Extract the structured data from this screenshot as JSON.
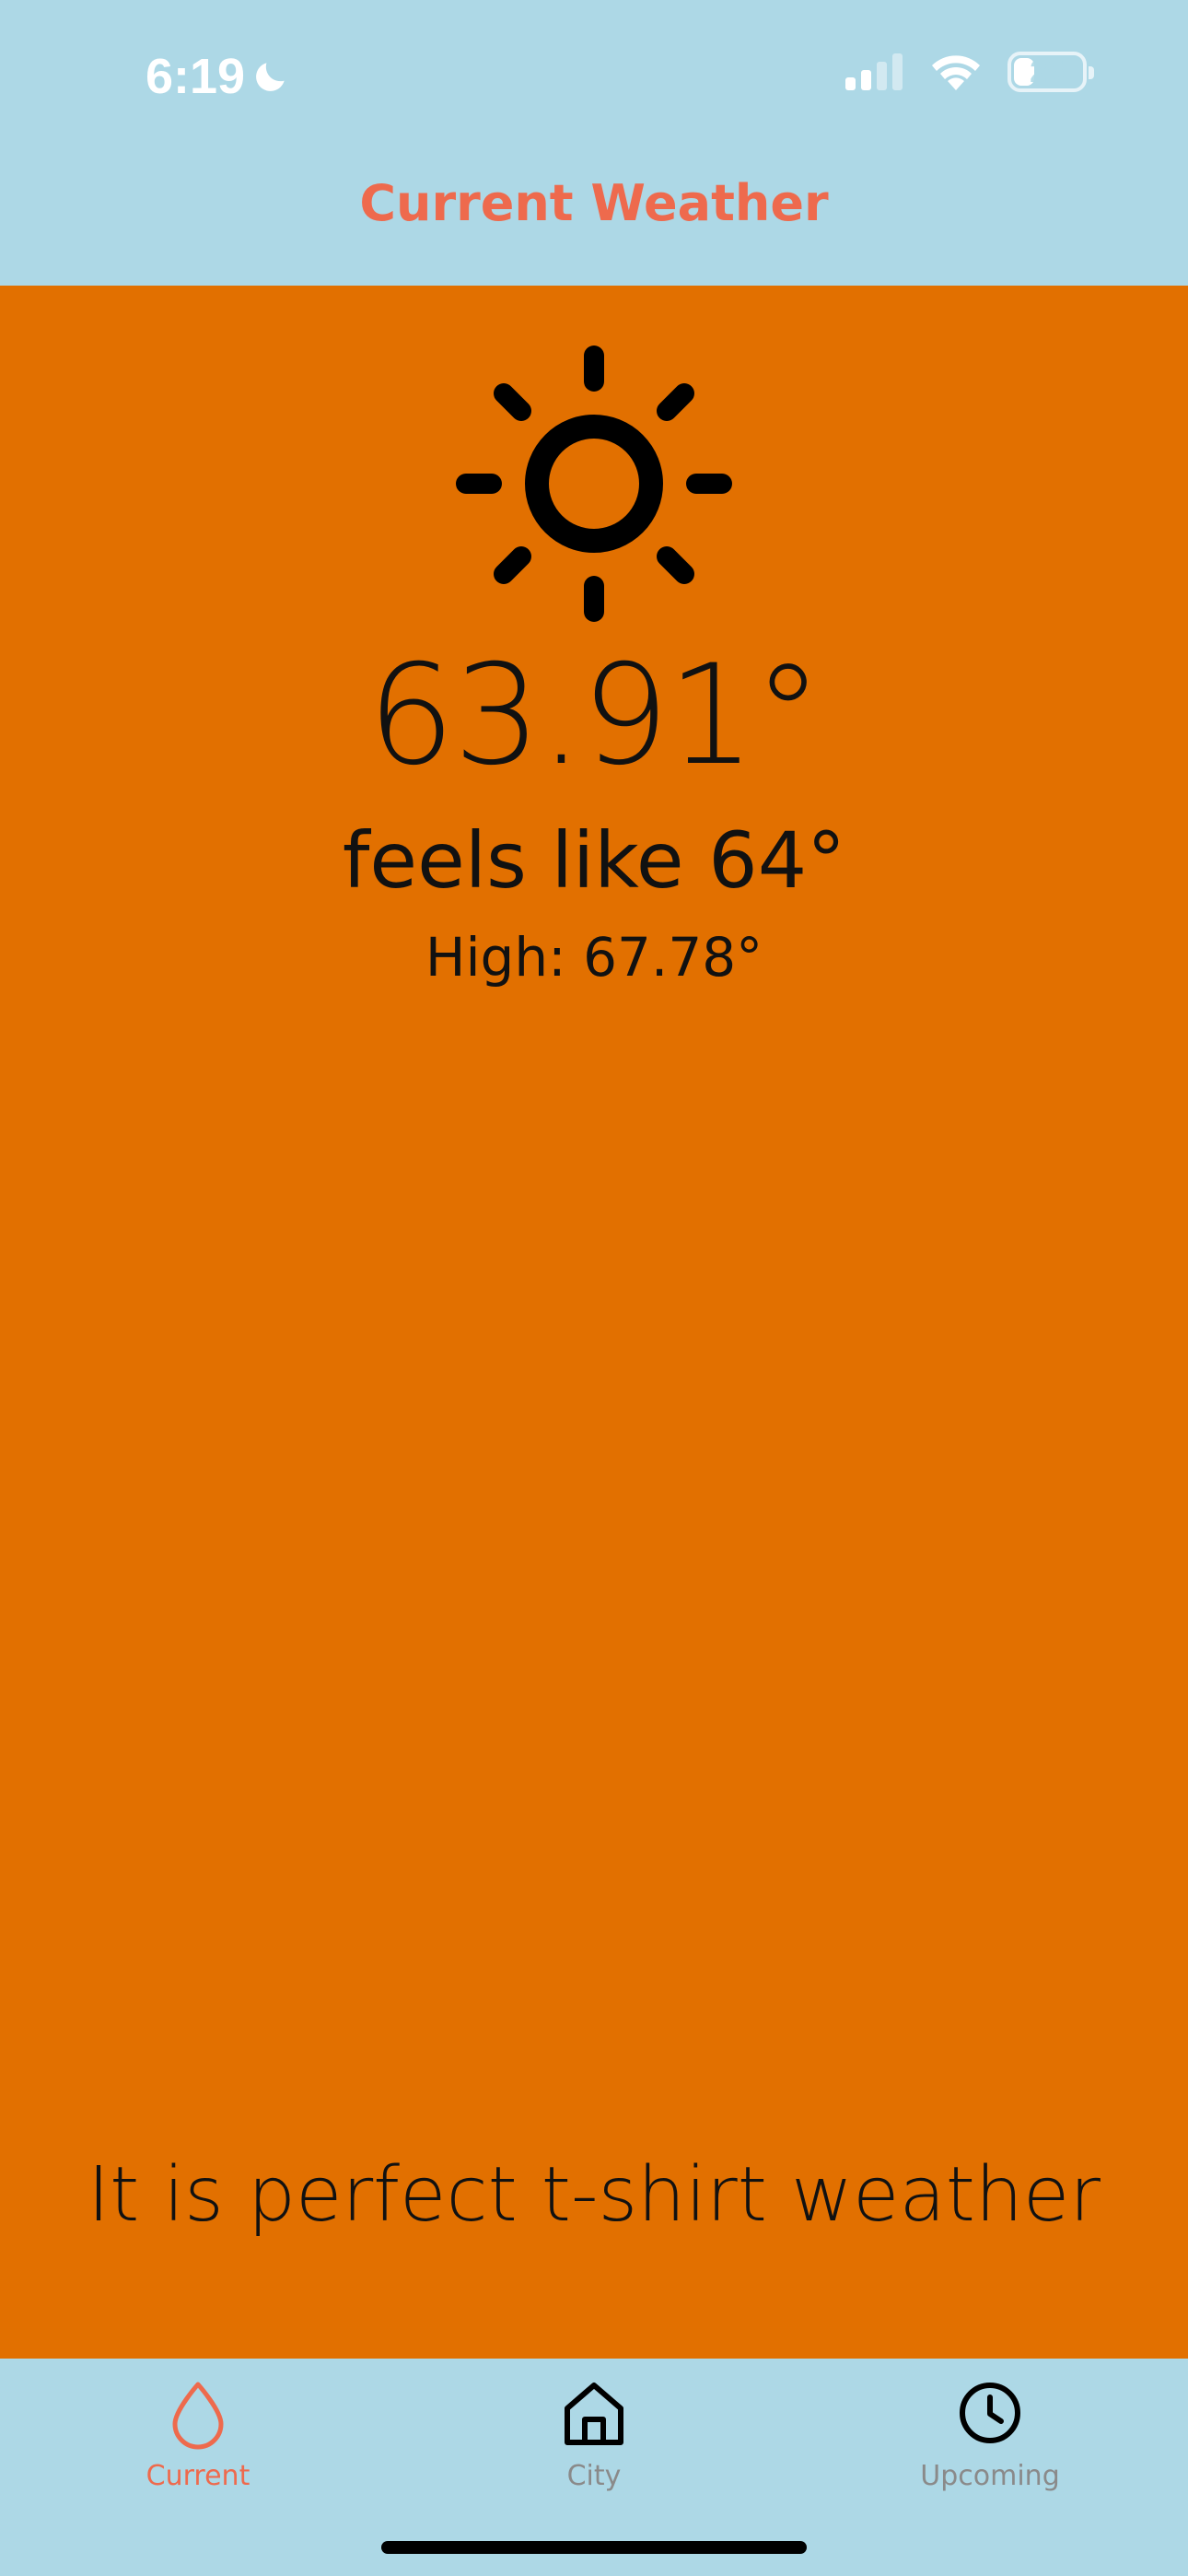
{
  "status": {
    "time": "6:19",
    "battery": "25"
  },
  "header": {
    "title": "Current Weather"
  },
  "weather": {
    "icon": "sun-icon",
    "temperature": "63.91°",
    "feels_like": "feels like 64°",
    "high": "High: 67.78°",
    "message": "It is perfect t-shirt weather"
  },
  "tabs": [
    {
      "label": "Current",
      "icon": "droplet-icon",
      "active": true
    },
    {
      "label": "City",
      "icon": "home-icon",
      "active": false
    },
    {
      "label": "Upcoming",
      "icon": "clock-icon",
      "active": false
    }
  ],
  "colors": {
    "accent": "#EE6A4D",
    "background": "#ADD8E6",
    "content": "#E27000"
  }
}
